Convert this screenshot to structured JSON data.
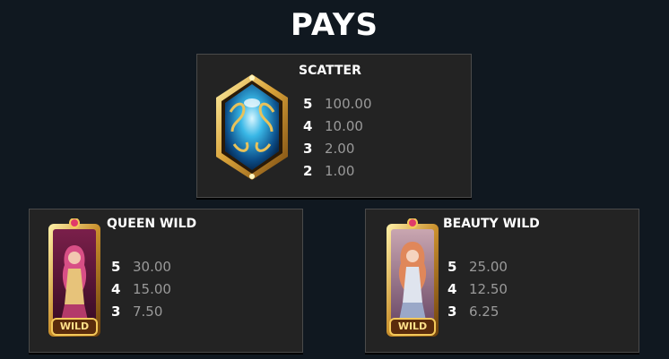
{
  "header": {
    "title": "PAYS"
  },
  "symbols": [
    {
      "name": "SCATTER",
      "icon": "blue-orb-scatter-icon",
      "pays": [
        {
          "count": "5",
          "value": "100.00"
        },
        {
          "count": "4",
          "value": "10.00"
        },
        {
          "count": "3",
          "value": "2.00"
        },
        {
          "count": "2",
          "value": "1.00"
        }
      ]
    },
    {
      "name": "QUEEN WILD",
      "icon": "queen-wild-icon",
      "badge": "WILD",
      "pays": [
        {
          "count": "5",
          "value": "30.00"
        },
        {
          "count": "4",
          "value": "15.00"
        },
        {
          "count": "3",
          "value": "7.50"
        }
      ]
    },
    {
      "name": "BEAUTY WILD",
      "icon": "beauty-wild-icon",
      "badge": "WILD",
      "pays": [
        {
          "count": "5",
          "value": "25.00"
        },
        {
          "count": "4",
          "value": "12.50"
        },
        {
          "count": "3",
          "value": "6.25"
        }
      ]
    }
  ]
}
